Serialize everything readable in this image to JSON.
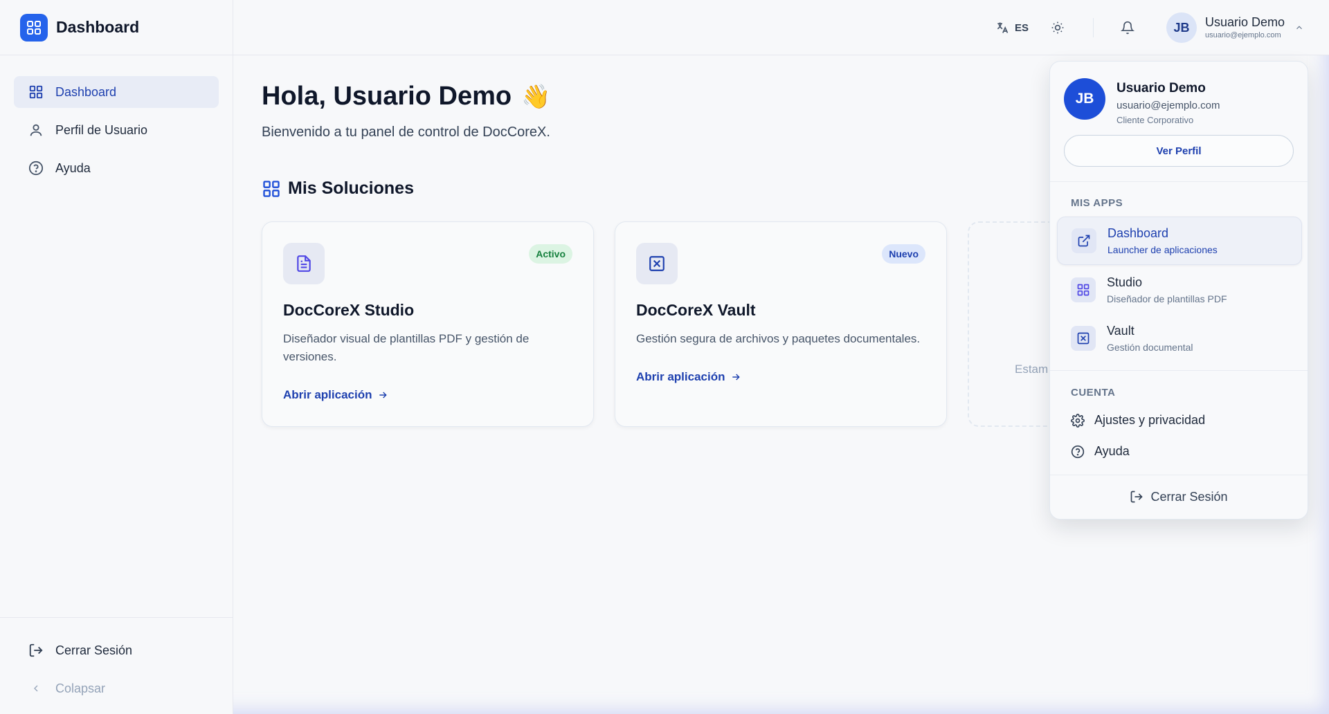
{
  "brand": {
    "title": "Dashboard"
  },
  "sidebar": {
    "items": [
      {
        "label": "Dashboard",
        "icon": "grid-icon",
        "active": true
      },
      {
        "label": "Perfil de Usuario",
        "icon": "user-icon"
      },
      {
        "label": "Ayuda",
        "icon": "help-circle-icon"
      }
    ],
    "logout_label": "Cerrar Sesión",
    "collapse_label": "Colapsar"
  },
  "header": {
    "language": "ES",
    "user_initials": "JB",
    "user_name": "Usuario Demo",
    "user_email": "usuario@ejemplo.com"
  },
  "main": {
    "greeting": "Hola, Usuario Demo",
    "wave": "👋",
    "welcome": "Bienvenido a tu panel de control de DocCoreX.",
    "section_title": "Mis Soluciones",
    "cards": [
      {
        "title": "DocCoreX Studio",
        "badge": "Activo",
        "description": "Diseñador visual de plantillas PDF y gestión de versiones.",
        "link": "Abrir aplicación"
      },
      {
        "title": "DocCoreX Vault",
        "badge": "Nuevo",
        "description": "Gestión segura de archivos y paquetes documentales.",
        "link": "Abrir aplicación"
      }
    ],
    "placeholder_card_text": "Estam"
  },
  "dropdown": {
    "initials": "JB",
    "name": "Usuario Demo",
    "email": "usuario@ejemplo.com",
    "role": "Cliente Corporativo",
    "view_profile": "Ver Perfil",
    "apps_section": "MIS APPS",
    "apps": [
      {
        "name": "Dashboard",
        "subtitle": "Launcher de aplicaciones",
        "icon": "external-link-icon"
      },
      {
        "name": "Studio",
        "subtitle": "Diseñador de plantillas PDF",
        "icon": "grid-icon"
      },
      {
        "name": "Vault",
        "subtitle": "Gestión documental",
        "icon": "vault-icon"
      }
    ],
    "account_section": "CUENTA",
    "settings_label": "Ajustes y privacidad",
    "help_label": "Ayuda",
    "logout_label": "Cerrar Sesión"
  },
  "colors": {
    "accent": "#2563eb",
    "accent_dark": "#1e40af",
    "badge_active": "#15803d",
    "badge_new": "#1e40af"
  }
}
